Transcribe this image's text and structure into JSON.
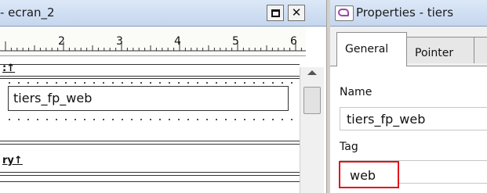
{
  "left_window": {
    "title": "- ecran_2",
    "restore_icon": "restore-icon",
    "close_label": "✕",
    "ruler_numbers": [
      "2",
      "3",
      "4",
      "5",
      "6"
    ],
    "band_marker_1": ":↑",
    "field_value": "tiers_fp_web",
    "band_marker_2": "ry↑"
  },
  "properties_window": {
    "title": "Properties - tiers",
    "tabs": [
      {
        "label": "General",
        "active": true
      },
      {
        "label": "Pointer",
        "active": false
      }
    ],
    "name_label": "Name",
    "name_value": "tiers_fp_web",
    "tag_label": "Tag",
    "tag_value": "web",
    "highlight_color": "#e3121a"
  }
}
